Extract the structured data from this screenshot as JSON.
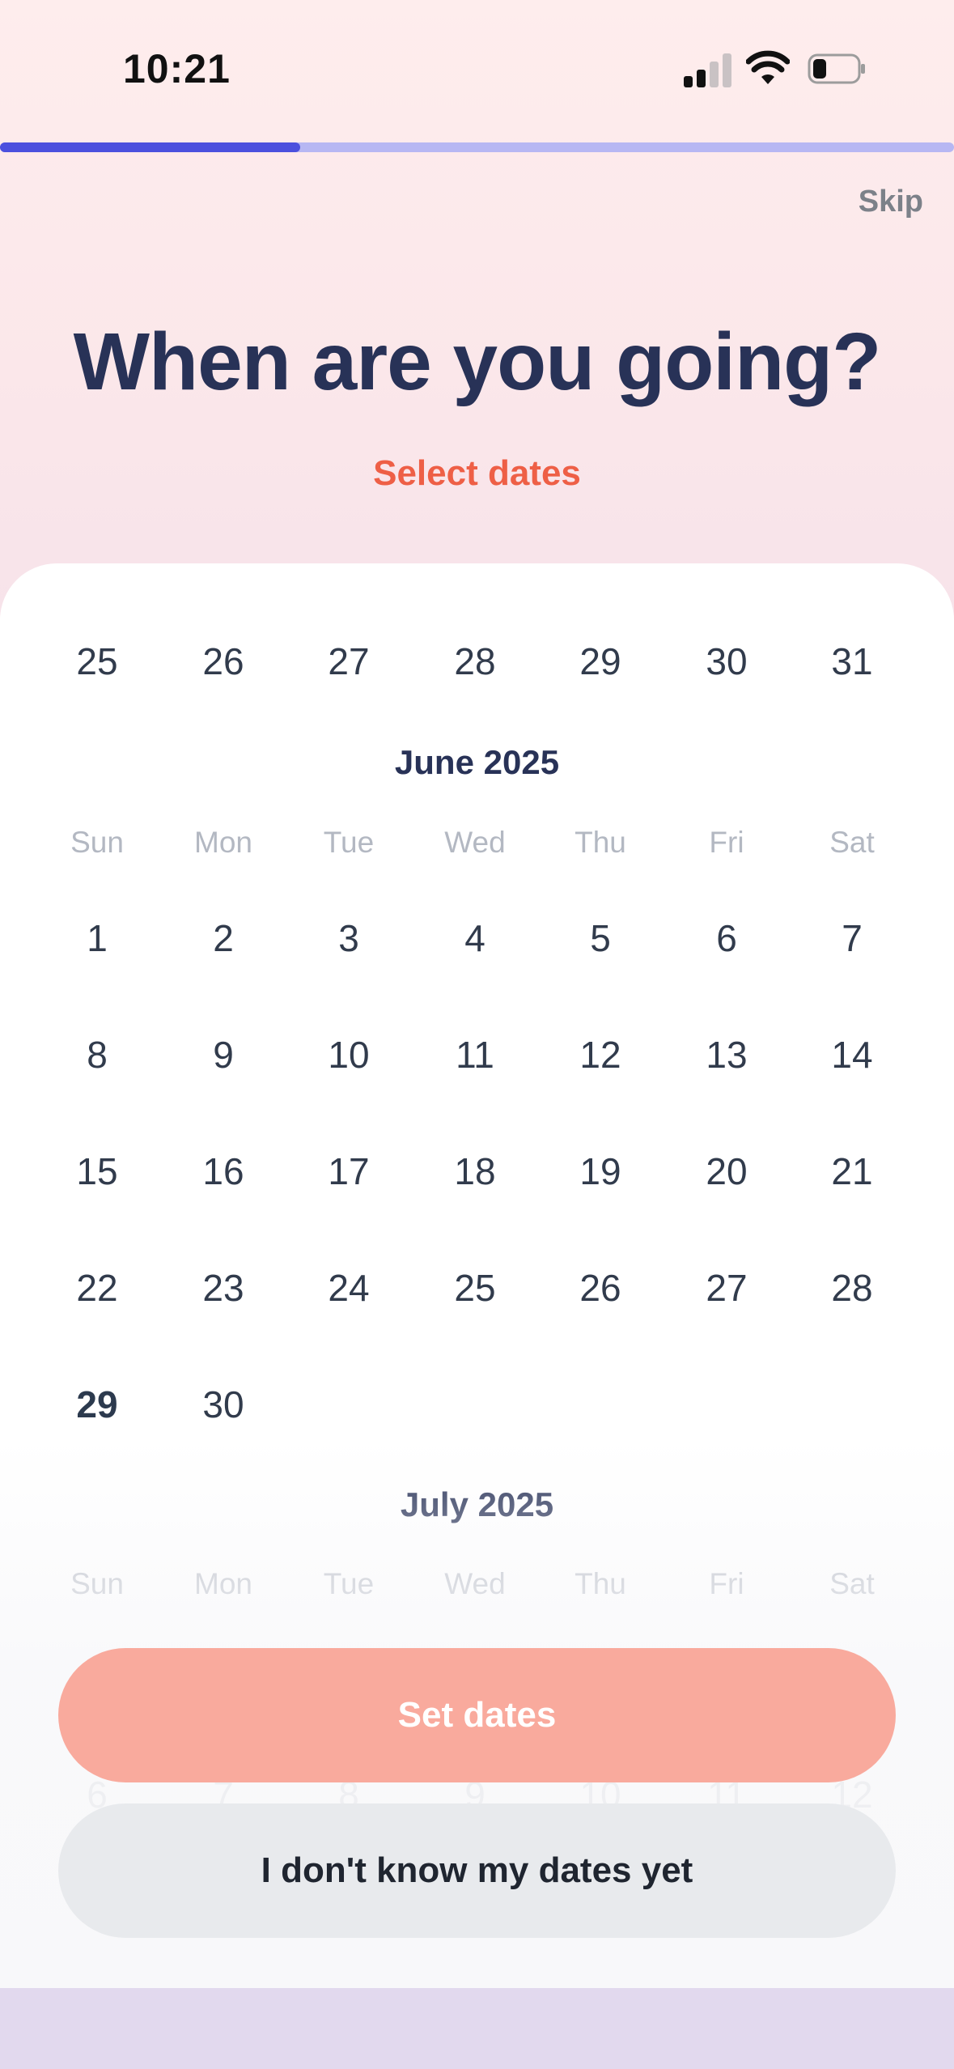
{
  "status_bar": {
    "time": "10:21"
  },
  "progress": {
    "fraction": 0.315
  },
  "header": {
    "skip_label": "Skip",
    "title": "When are you going?",
    "subtitle": "Select dates"
  },
  "calendar": {
    "prev_tail": [
      "25",
      "26",
      "27",
      "28",
      "29",
      "30",
      "31"
    ],
    "weekdays": [
      "Sun",
      "Mon",
      "Tue",
      "Wed",
      "Thu",
      "Fri",
      "Sat"
    ],
    "june": {
      "label": "June 2025",
      "weeks": [
        [
          "1",
          "2",
          "3",
          "4",
          "5",
          "6",
          "7"
        ],
        [
          "8",
          "9",
          "10",
          "11",
          "12",
          "13",
          "14"
        ],
        [
          "15",
          "16",
          "17",
          "18",
          "19",
          "20",
          "21"
        ],
        [
          "22",
          "23",
          "24",
          "25",
          "26",
          "27",
          "28"
        ],
        [
          "29",
          "30"
        ]
      ],
      "today": "29"
    },
    "july": {
      "label": "July 2025",
      "partial_row": [
        "6",
        "7",
        "8",
        "9",
        "10",
        "11",
        "12"
      ]
    }
  },
  "actions": {
    "set_dates": "Set dates",
    "unknown_dates": "I don't know my dates yet"
  },
  "colors": {
    "accent": "#ee5f46",
    "primary_button": "#f9aa9d",
    "progress_fill": "#4b50de",
    "progress_track": "#b7b7f3",
    "title": "#283257"
  }
}
